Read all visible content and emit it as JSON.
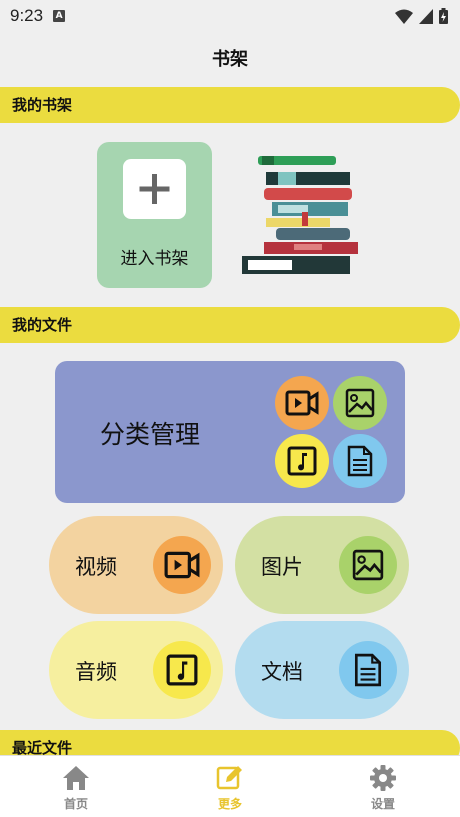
{
  "status_bar": {
    "time": "9:23",
    "notification_badge": "A"
  },
  "header": {
    "title": "书架"
  },
  "sections": {
    "bookshelf": "我的书架",
    "files": "我的文件",
    "recent": "最近文件"
  },
  "bookshelf": {
    "enter_label": "进入书架"
  },
  "category": {
    "title": "分类管理"
  },
  "file_types": {
    "video": "视频",
    "image": "图片",
    "audio": "音频",
    "document": "文档"
  },
  "bottom_nav": {
    "items": [
      {
        "label": "首页",
        "icon": "home-icon"
      },
      {
        "label": "更多",
        "icon": "edit-icon",
        "active": true
      },
      {
        "label": "设置",
        "icon": "gear-icon"
      }
    ]
  },
  "colors": {
    "section_header": "#ebdc3f",
    "bookshelf_card": "#a6d5b0",
    "category_card": "#8b97cd",
    "video_pill": "#f3d3a0",
    "image_pill": "#d3e0a3",
    "audio_pill": "#f6ef9f",
    "document_pill": "#b3dcef",
    "nav_active": "#e8c42d"
  }
}
